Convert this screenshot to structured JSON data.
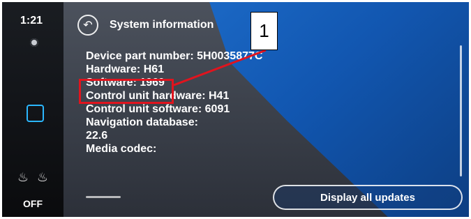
{
  "status": {
    "clock": "1:21",
    "seat_status": "OFF"
  },
  "header": {
    "back_icon": "back-arrow-icon",
    "title": "System information"
  },
  "system_info": {
    "lines": [
      "Device part number: 5H0035877C",
      "Hardware: H61",
      "Software: 1969",
      "Control unit hardware: H41",
      "Control unit software: 6091",
      "Navigation database:",
      "22.6",
      "Media codec:"
    ]
  },
  "actions": {
    "display_all_updates": "Display all updates"
  },
  "annotation": {
    "number": "1",
    "color": "#e0141e"
  },
  "colors": {
    "accent_blue": "#1f76d9",
    "home_square": "#2bb7ff"
  }
}
